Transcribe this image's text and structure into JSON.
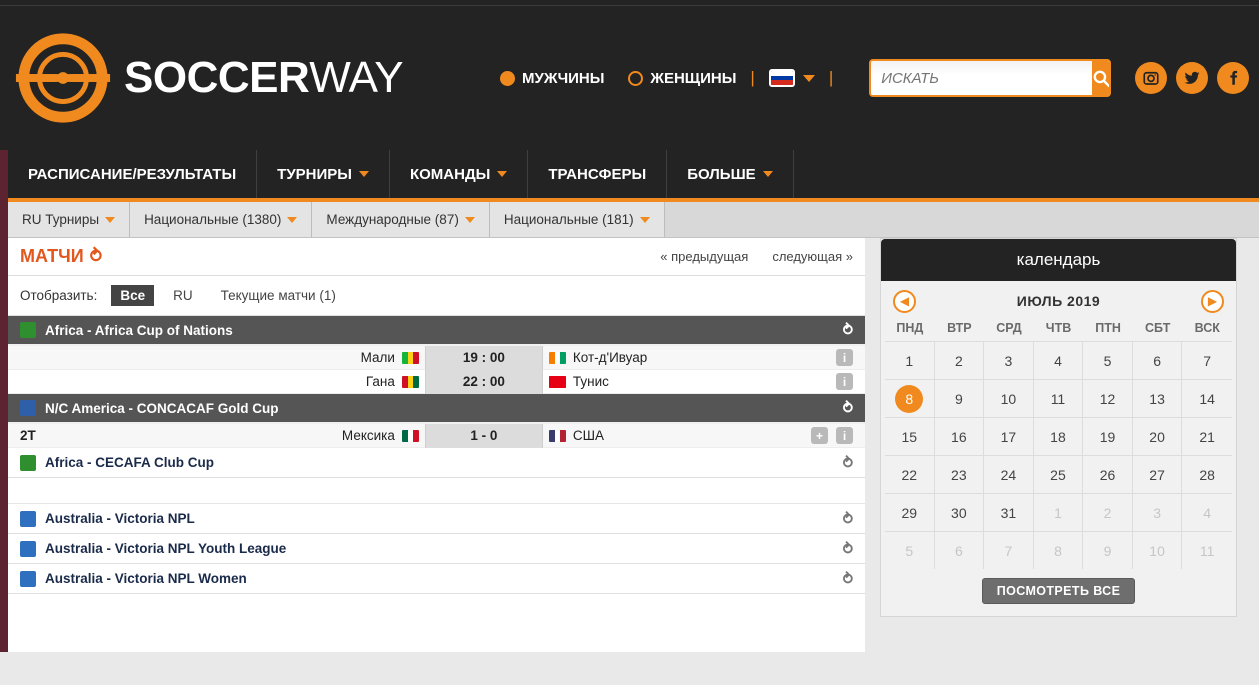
{
  "brand": {
    "name_bold": "SOCCER",
    "name_light": "WAY"
  },
  "header": {
    "gender_men": "МУЖЧИНЫ",
    "gender_women": "ЖЕНЩИНЫ",
    "divider": "|",
    "language_flag": "ru-flag-icon",
    "search_placeholder": "ИСКАТЬ",
    "search_value": "",
    "socials": [
      "instagram-icon",
      "twitter-icon",
      "facebook-icon"
    ],
    "accent_color": "#f08a1e",
    "bg_color": "#232323"
  },
  "mainnav": [
    {
      "label": "РАСПИСАНИЕ/РЕЗУЛЬТАТЫ",
      "caret": false
    },
    {
      "label": "ТУРНИРЫ",
      "caret": true
    },
    {
      "label": "КОМАНДЫ",
      "caret": true
    },
    {
      "label": "ТРАНСФЕРЫ",
      "caret": false
    },
    {
      "label": "БОЛЬШЕ",
      "caret": true
    }
  ],
  "subnav": [
    {
      "label": "RU Турниры"
    },
    {
      "label": "Национальные (1380)"
    },
    {
      "label": "Международные (87)"
    },
    {
      "label": "Национальные (181)"
    }
  ],
  "main": {
    "title": "МАТЧИ",
    "prev_label": "« предыдущая",
    "next_label": "следующая »",
    "filter_label": "Отобразить:",
    "filters": [
      {
        "label": "Все",
        "active": true
      },
      {
        "label": "RU",
        "active": false
      },
      {
        "label": "Текущие матчи (1)",
        "active": false
      }
    ]
  },
  "groups": [
    {
      "name": "Africa - Africa Cup of Nations",
      "icon": "africa-flag-icon",
      "icon_color": "#2f8f2f",
      "style": "dark",
      "matches": [
        {
          "status": "",
          "home": "Мали",
          "home_flag": [
            "#14b53a",
            "#fcd116",
            "#ce1126"
          ],
          "score": "19 : 00",
          "away": "Кот-д'Ивуар",
          "away_flag": [
            "#f77f00",
            "#ffffff",
            "#009e60"
          ],
          "icons": [
            "info-icon"
          ]
        },
        {
          "status": "",
          "home": "Гана",
          "home_flag": [
            "#ce1126",
            "#fcd116",
            "#006b3f"
          ],
          "score": "22 : 00",
          "away": "Тунис",
          "away_flag": [
            "#e70013",
            "#e70013",
            "#e70013"
          ],
          "icons": [
            "info-icon"
          ]
        }
      ]
    },
    {
      "name": "N/C America - CONCACAF Gold Cup",
      "icon": "concacaf-icon",
      "icon_color": "#2f5fa8",
      "style": "dark",
      "matches": [
        {
          "status": "2Т",
          "home": "Мексика",
          "home_flag": [
            "#006847",
            "#ffffff",
            "#ce1126"
          ],
          "score": "1 - 0",
          "away": "США",
          "away_flag": [
            "#3c3b6e",
            "#ffffff",
            "#b22234"
          ],
          "icons": [
            "plus-icon",
            "info-icon"
          ]
        }
      ]
    },
    {
      "name": "Africa - CECAFA Club Cup",
      "icon": "africa-flag-icon",
      "icon_color": "#2f8f2f",
      "style": "light",
      "matches": []
    }
  ],
  "leagues": [
    {
      "name": "Australia - Victoria NPL",
      "icon": "australia-flag-icon"
    },
    {
      "name": "Australia - Victoria NPL Youth League",
      "icon": "australia-flag-icon"
    },
    {
      "name": "Australia - Victoria NPL Women",
      "icon": "australia-flag-icon"
    }
  ],
  "calendar": {
    "title": "календарь",
    "month": "ИЮЛЬ 2019",
    "prev_icon": "arrow-left-icon",
    "next_icon": "arrow-right-icon",
    "dows": [
      "ПНД",
      "ВТР",
      "СРД",
      "ЧТВ",
      "ПТН",
      "СБТ",
      "ВСК"
    ],
    "selected_day": 8,
    "days": [
      {
        "n": 1,
        "mute": false
      },
      {
        "n": 2,
        "mute": false
      },
      {
        "n": 3,
        "mute": false
      },
      {
        "n": 4,
        "mute": false
      },
      {
        "n": 5,
        "mute": false
      },
      {
        "n": 6,
        "mute": false
      },
      {
        "n": 7,
        "mute": false
      },
      {
        "n": 8,
        "mute": false
      },
      {
        "n": 9,
        "mute": false
      },
      {
        "n": 10,
        "mute": false
      },
      {
        "n": 11,
        "mute": false
      },
      {
        "n": 12,
        "mute": false
      },
      {
        "n": 13,
        "mute": false
      },
      {
        "n": 14,
        "mute": false
      },
      {
        "n": 15,
        "mute": false
      },
      {
        "n": 16,
        "mute": false
      },
      {
        "n": 17,
        "mute": false
      },
      {
        "n": 18,
        "mute": false
      },
      {
        "n": 19,
        "mute": false
      },
      {
        "n": 20,
        "mute": false
      },
      {
        "n": 21,
        "mute": false
      },
      {
        "n": 22,
        "mute": false
      },
      {
        "n": 23,
        "mute": false
      },
      {
        "n": 24,
        "mute": false
      },
      {
        "n": 25,
        "mute": false
      },
      {
        "n": 26,
        "mute": false
      },
      {
        "n": 27,
        "mute": false
      },
      {
        "n": 28,
        "mute": false
      },
      {
        "n": 29,
        "mute": false
      },
      {
        "n": 30,
        "mute": false
      },
      {
        "n": 31,
        "mute": false
      },
      {
        "n": 1,
        "mute": true
      },
      {
        "n": 2,
        "mute": true
      },
      {
        "n": 3,
        "mute": true
      },
      {
        "n": 4,
        "mute": true
      },
      {
        "n": 5,
        "mute": true
      },
      {
        "n": 6,
        "mute": true
      },
      {
        "n": 7,
        "mute": true
      },
      {
        "n": 8,
        "mute": true
      },
      {
        "n": 9,
        "mute": true
      },
      {
        "n": 10,
        "mute": true
      },
      {
        "n": 11,
        "mute": true
      }
    ],
    "view_all": "ПОСМОТРЕТЬ ВСЕ"
  }
}
